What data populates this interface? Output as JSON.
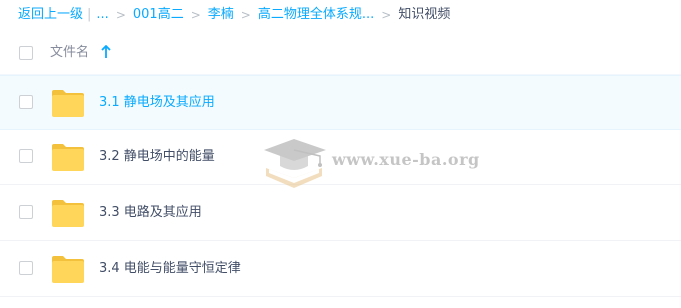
{
  "breadcrumb": {
    "back_label": "返回上一级",
    "ellipsis": "...",
    "items": [
      {
        "label": "001高二"
      },
      {
        "label": "李楠"
      },
      {
        "label": "高二物理全体系规..."
      }
    ],
    "current": "知识视频"
  },
  "header": {
    "column_label": "文件名"
  },
  "files": [
    {
      "name": "3.1 静电场及其应用",
      "active": true
    },
    {
      "name": "3.2 静电场中的能量",
      "active": false
    },
    {
      "name": "3.3 电路及其应用",
      "active": false
    },
    {
      "name": "3.4 电能与能量守恒定律",
      "active": false
    }
  ],
  "watermark": {
    "text": "www.xue-ba.org"
  },
  "colors": {
    "accent": "#09aaff",
    "folder": "#ffd659",
    "folder_tab": "#f3c13c",
    "text": "#424e67"
  }
}
